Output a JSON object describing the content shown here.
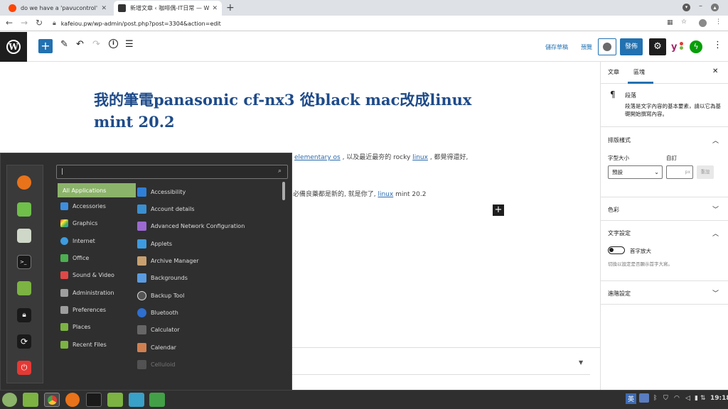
{
  "browser": {
    "tabs": [
      {
        "title": "do we have a 'pavucontrol' lik",
        "favicon": "reddit-icon",
        "favcolor": "#ff4500",
        "active": false
      },
      {
        "title": "新增文章 ‹ 咖啡偶-IT日常 — W",
        "favicon": "site-icon",
        "favcolor": "#333333",
        "active": true
      }
    ],
    "url": "kafeiou.pw/wp-admin/post.php?post=3304&action=edit"
  },
  "wp": {
    "save_draft": "儲存草稿",
    "preview": "預覽",
    "publish": "發佈"
  },
  "post": {
    "title": "我的筆電panasonic cf-nx3 從black mac改成linux mint 20.2",
    "para1_pre": "",
    "para1_frag": "elementary os",
    "para1_mid": " , 以及最近最夯的 rocky ",
    "para1_link": "linux",
    "para1_post": " , 都覺得還好,",
    "para2_pre": "必備良藥都是新的, 就是你了, ",
    "para2_link": "linux",
    "para2_post": " mint 20.2"
  },
  "sidebar": {
    "tab_post": "文章",
    "tab_block": "區塊",
    "block_name": "段落",
    "block_desc": "段落是文字內容的基本要素，請以它為基礎開始撰寫內容。",
    "typography": "排版樣式",
    "font_size_label": "字型大小",
    "custom_label": "自訂",
    "font_size_value": "預設",
    "px_unit": "px",
    "reset": "重設",
    "color": "色彩",
    "text_settings": "文字設定",
    "drop_cap": "首字放大",
    "drop_cap_help": "切換以設定是否顯示首字大寫。",
    "advanced": "進階設定"
  },
  "menu": {
    "search_value": "|",
    "categories": [
      {
        "label": "All Applications",
        "color": "#8bb36a"
      },
      {
        "label": "Accessories",
        "color": "#3d8ee0"
      },
      {
        "label": "Graphics",
        "color": "#e85aa0"
      },
      {
        "label": "Internet",
        "color": "#3d9be0"
      },
      {
        "label": "Office",
        "color": "#4caf50"
      },
      {
        "label": "Sound & Video",
        "color": "#e04848"
      },
      {
        "label": "Administration",
        "color": "#9e9e9e"
      },
      {
        "label": "Preferences",
        "color": "#9e9e9e"
      },
      {
        "label": "Places",
        "color": "#7cb342"
      },
      {
        "label": "Recent Files",
        "color": "#7cb342"
      }
    ],
    "apps": [
      {
        "label": "Accessibility",
        "color": "#2f7fd8"
      },
      {
        "label": "Account details",
        "color": "#3a8fd0"
      },
      {
        "label": "Advanced Network Configuration",
        "color": "#9c6ad0"
      },
      {
        "label": "Applets",
        "color": "#3d9be0"
      },
      {
        "label": "Archive Manager",
        "color": "#c8a070"
      },
      {
        "label": "Backgrounds",
        "color": "#5a9be0"
      },
      {
        "label": "Backup Tool",
        "color": "#555555"
      },
      {
        "label": "Bluetooth",
        "color": "#2f6fd0"
      },
      {
        "label": "Calculator",
        "color": "#666666"
      },
      {
        "label": "Calendar",
        "color": "#d08050"
      },
      {
        "label": "Celluloid",
        "color": "#888888"
      }
    ]
  },
  "taskbar": {
    "clock": "19:18",
    "ime": "英"
  }
}
